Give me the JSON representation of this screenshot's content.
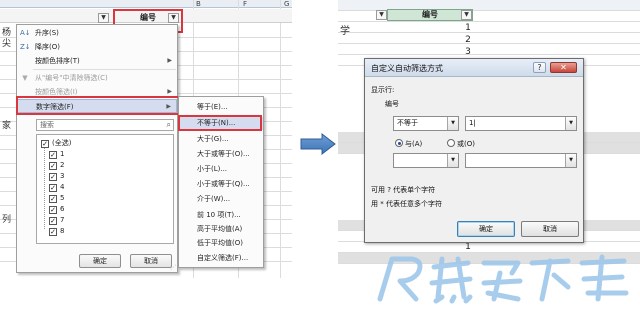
{
  "left": {
    "col_letters": [
      "B",
      "F",
      "G"
    ],
    "header_label": "编号",
    "sheet_fragments": [
      "杨",
      "尖",
      "家",
      "列"
    ],
    "menu": {
      "items": [
        {
          "label": "升序(S)",
          "icon": "sort-asc-icon",
          "disabled": false,
          "submenu": false
        },
        {
          "label": "降序(O)",
          "icon": "sort-desc-icon",
          "disabled": false,
          "submenu": false
        },
        {
          "label": "按颜色排序(T)",
          "icon": "",
          "disabled": false,
          "submenu": true
        },
        {
          "label": "从\"编号\"中清除筛选(C)",
          "icon": "clear-filter-icon",
          "disabled": true,
          "submenu": false
        },
        {
          "label": "按颜色筛选(I)",
          "icon": "",
          "disabled": true,
          "submenu": true
        },
        {
          "label": "数字筛选(F)",
          "icon": "",
          "disabled": false,
          "submenu": true
        }
      ],
      "search_placeholder": "搜索",
      "checklist": [
        "(全选)",
        "1",
        "2",
        "3",
        "4",
        "5",
        "6",
        "7",
        "8"
      ],
      "ok": "确定",
      "cancel": "取消"
    },
    "submenu": [
      "等于(E)...",
      "不等于(N)...",
      "大于(G)...",
      "大于或等于(O)...",
      "小于(L)...",
      "小于或等于(Q)...",
      "介于(W)...",
      "前 10 项(T)...",
      "高于平均值(A)",
      "低于平均值(O)",
      "自定义筛选(F)..."
    ]
  },
  "right": {
    "header_label": "编号",
    "row_fragment": "学",
    "numbers": [
      "1",
      "2",
      "3"
    ],
    "bottom_number": "1",
    "dialog": {
      "title": "自定义自动筛选方式",
      "show_rows": "显示行:",
      "field": "编号",
      "op1": "不等于",
      "val1": "1",
      "and_label": "与(A)",
      "or_label": "或(O)",
      "hint1": "可用 ? 代表单个字符",
      "hint2": "用 * 代表任意多个字符",
      "ok": "确定",
      "cancel": "取消",
      "help": "?"
    }
  },
  "colors": {
    "highlight": "#d9363e",
    "header_green": "#cfe6d7",
    "watermark": "#9fc8ea"
  }
}
